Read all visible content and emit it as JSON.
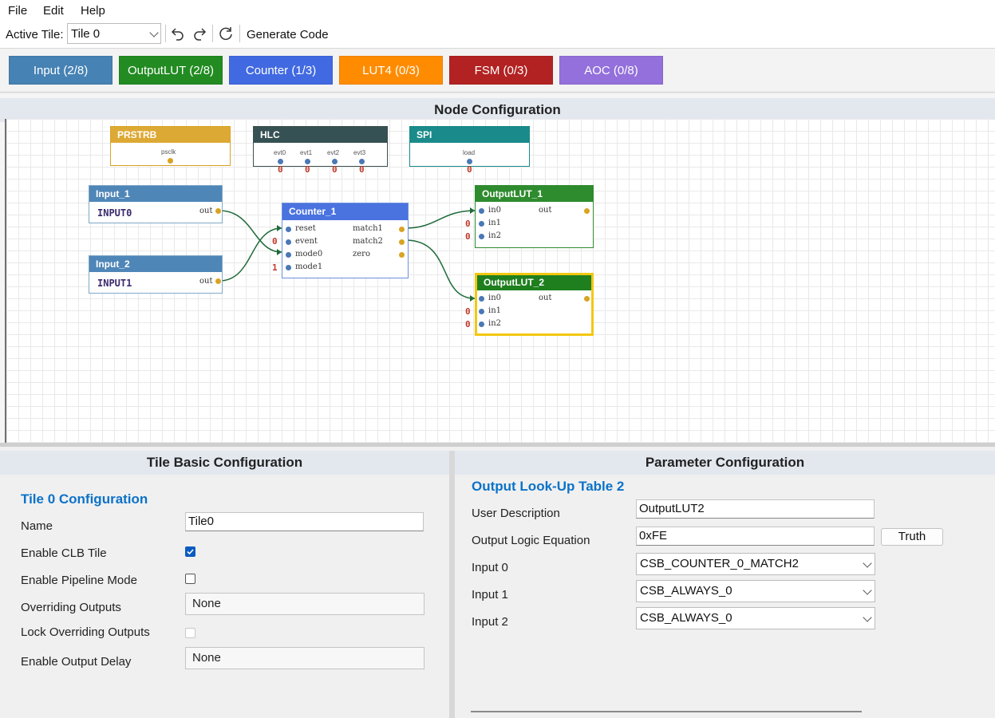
{
  "menu": {
    "file": "File",
    "edit": "Edit",
    "help": "Help"
  },
  "toolbar": {
    "active_tile_label": "Active Tile:",
    "active_tile_value": "Tile 0",
    "generate_label": "Generate Code",
    "undo_icon": "undo-icon",
    "redo_icon": "redo-icon",
    "refresh_icon": "refresh-icon"
  },
  "categories": [
    {
      "label": "Input (2/8)",
      "color": "#4682b4"
    },
    {
      "label": "OutputLUT (2/8)",
      "color": "#228b22"
    },
    {
      "label": "Counter (1/3)",
      "color": "#4169e1"
    },
    {
      "label": "LUT4 (0/3)",
      "color": "#ff8c00"
    },
    {
      "label": "FSM (0/3)",
      "color": "#b22222"
    },
    {
      "label": "AOC (0/8)",
      "color": "#9370db"
    }
  ],
  "node_panel": {
    "title": "Node Configuration",
    "nodes": {
      "prstrb": {
        "title": "PRSTRB",
        "port": "psclk"
      },
      "hlc": {
        "title": "HLC",
        "ports": [
          "evt0",
          "evt1",
          "evt2",
          "evt3"
        ],
        "values": [
          "0",
          "0",
          "0",
          "0"
        ]
      },
      "spi": {
        "title": "SPI",
        "port": "load",
        "value": "0"
      },
      "input_1": {
        "title": "Input_1",
        "name": "INPUT0",
        "out": "out"
      },
      "input_2": {
        "title": "Input_2",
        "name": "INPUT1",
        "out": "out"
      },
      "counter_1": {
        "title": "Counter_1",
        "inputs": [
          "reset",
          "event",
          "mode0",
          "mode1"
        ],
        "outputs": [
          "match1",
          "match2",
          "zero"
        ],
        "event_value": "0",
        "mode1_value": "1"
      },
      "outputlut_1": {
        "title": "OutputLUT_1",
        "inputs": [
          "in0",
          "in1",
          "in2"
        ],
        "out": "out",
        "values": [
          "0",
          "0"
        ]
      },
      "outputlut_2": {
        "title": "OutputLUT_2",
        "inputs": [
          "in0",
          "in1",
          "in2"
        ],
        "out": "out",
        "values": [
          "0",
          "0"
        ]
      }
    }
  },
  "tile_panel": {
    "title": "Tile Basic Configuration",
    "section": "Tile 0 Configuration",
    "name_label": "Name",
    "name_value": "Tile0",
    "enable_clb_label": "Enable CLB Tile",
    "enable_clb_checked": true,
    "pipeline_label": "Enable Pipeline Mode",
    "pipeline_checked": false,
    "overriding_label": "Overriding Outputs",
    "overriding_value": "None",
    "lock_label": "Lock Overriding Outputs",
    "lock_checked": false,
    "delay_label": "Enable Output Delay",
    "delay_value": "None"
  },
  "param_panel": {
    "title": "Parameter Configuration",
    "section": "Output Look-Up Table 2",
    "desc_label": "User Description",
    "desc_value": "OutputLUT2",
    "equation_label": "Output Logic Equation",
    "equation_value": "0xFE",
    "truth_button": "Truth",
    "input0_label": "Input 0",
    "input0_value": "CSB_COUNTER_0_MATCH2",
    "input1_label": "Input 1",
    "input1_value": "CSB_ALWAYS_0",
    "input2_label": "Input 2",
    "input2_value": "CSB_ALWAYS_0"
  }
}
